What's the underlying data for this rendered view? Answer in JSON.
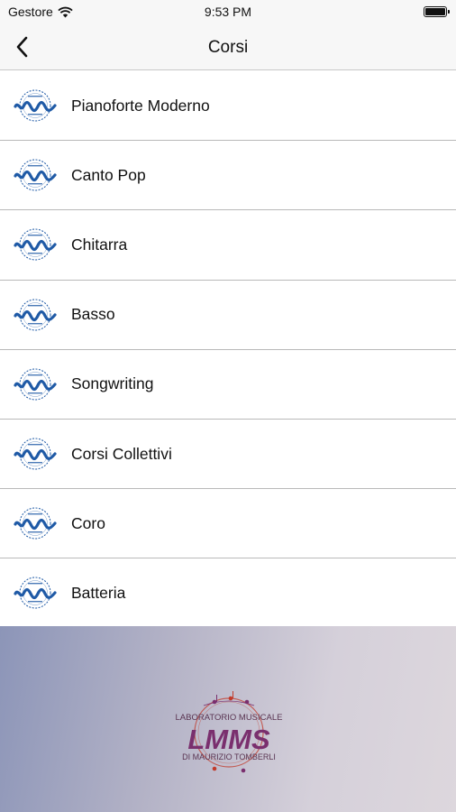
{
  "status_bar": {
    "carrier": "Gestore",
    "time": "9:53 PM"
  },
  "nav": {
    "title": "Corsi"
  },
  "courses": [
    {
      "label": "Pianoforte Moderno"
    },
    {
      "label": "Canto Pop"
    },
    {
      "label": "Chitarra"
    },
    {
      "label": "Basso"
    },
    {
      "label": "Songwriting"
    },
    {
      "label": "Corsi Collettivi"
    },
    {
      "label": "Coro"
    },
    {
      "label": "Batteria"
    }
  ],
  "row_icon": "lmms-academy-logo-icon",
  "footer": {
    "logo": "lmms-laboratorio-musicale-logo",
    "logo_text_top": "LABORATORIO MUSICALE",
    "logo_text_mark": "LMMS",
    "logo_text_bottom": "DI MAURIZIO TOMBERLI"
  },
  "colors": {
    "accent_blue": "#1f5aa6",
    "logo_red": "#c23a2a",
    "logo_purple": "#7a2f6e"
  }
}
